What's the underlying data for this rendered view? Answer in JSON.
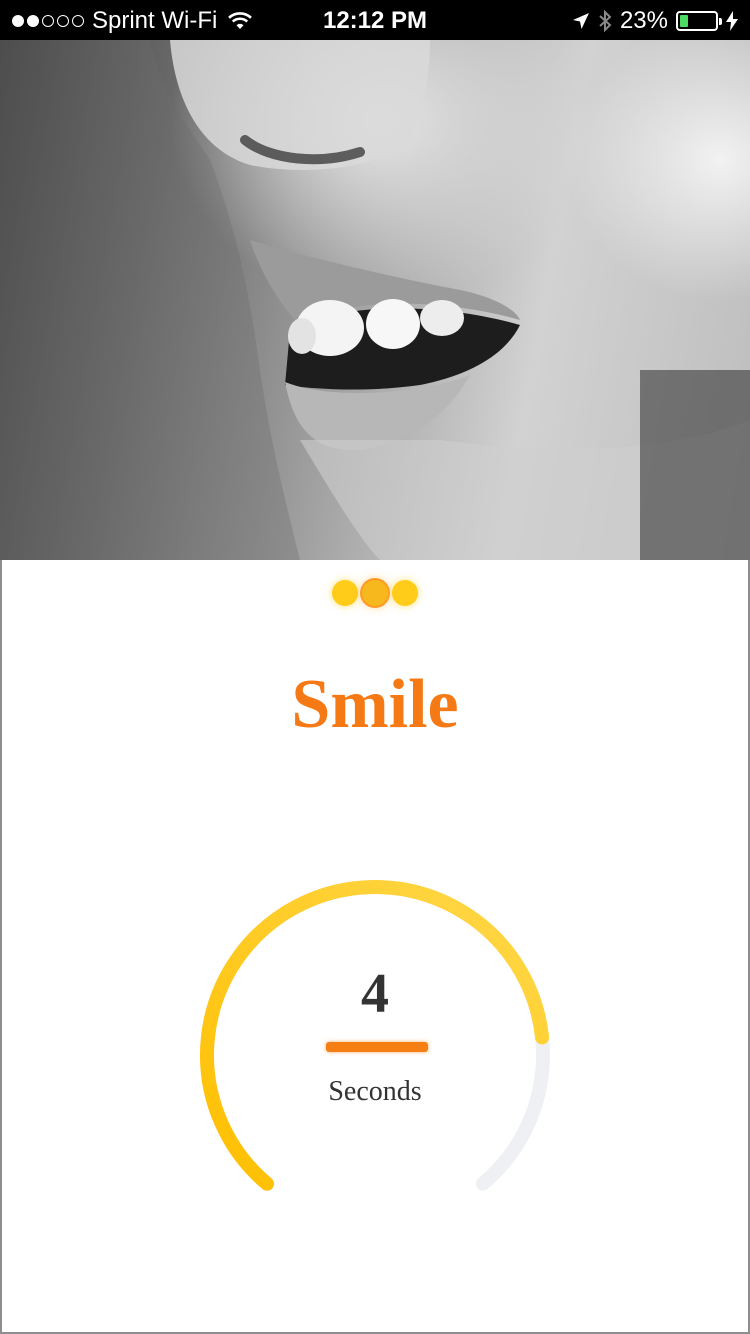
{
  "status_bar": {
    "carrier": "Sprint Wi-Fi",
    "time": "12:12 PM",
    "battery_percent": "23%",
    "battery_level": 0.23,
    "signal_bars_filled": 2,
    "signal_bars_total": 5
  },
  "photo": {
    "subject": "smiling-mouth-photo"
  },
  "pager": {
    "count": 3,
    "active_index": 1
  },
  "exercise": {
    "title": "Smile"
  },
  "timer": {
    "value": "4",
    "unit_label": "Seconds",
    "progress": 0.8
  },
  "colors": {
    "accent": "#f57a16",
    "arc_progress": "#ffc107",
    "arc_track": "#eef0f4",
    "pager_dot": "#ffcc1a"
  }
}
